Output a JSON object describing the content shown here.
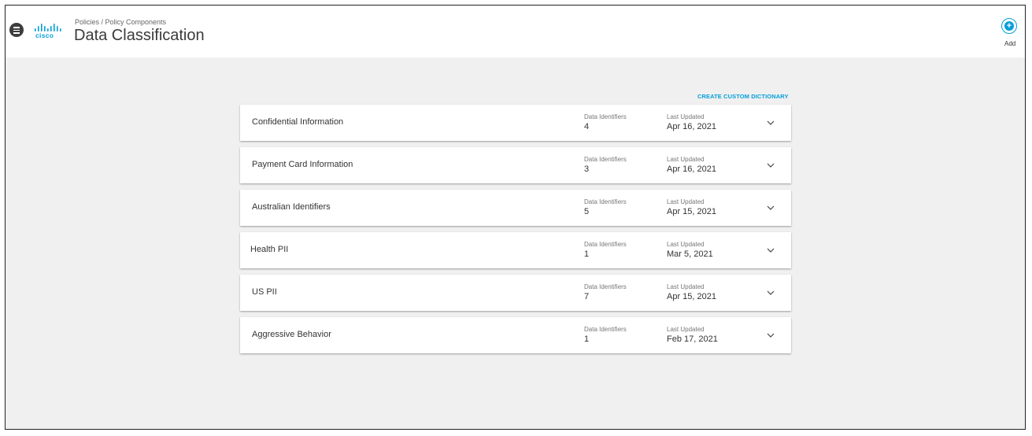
{
  "header": {
    "logo_text": "cisco",
    "breadcrumb": "Policies / Policy Components",
    "title": "Data Classification",
    "add_label": "Add"
  },
  "main": {
    "create_link": "CREATE CUSTOM DICTIONARY",
    "identifiers_label": "Data Identifiers",
    "updated_label": "Last Updated",
    "cards": [
      {
        "title": "Confidential Information",
        "identifiers": "4",
        "updated": "Apr 16, 2021"
      },
      {
        "title": "Payment Card Information",
        "identifiers": "3",
        "updated": "Apr 16, 2021"
      },
      {
        "title": "Australian Identifiers",
        "identifiers": "5",
        "updated": "Apr 15, 2021"
      },
      {
        "title": "Health PII",
        "identifiers": "1",
        "updated": "Mar 5, 2021"
      },
      {
        "title": "US PII",
        "identifiers": "7",
        "updated": "Apr 15, 2021"
      },
      {
        "title": "Aggressive Behavior",
        "identifiers": "1",
        "updated": "Feb 17, 2021"
      }
    ]
  },
  "colors": {
    "accent": "#049fd9",
    "background": "#f0f0f0"
  }
}
